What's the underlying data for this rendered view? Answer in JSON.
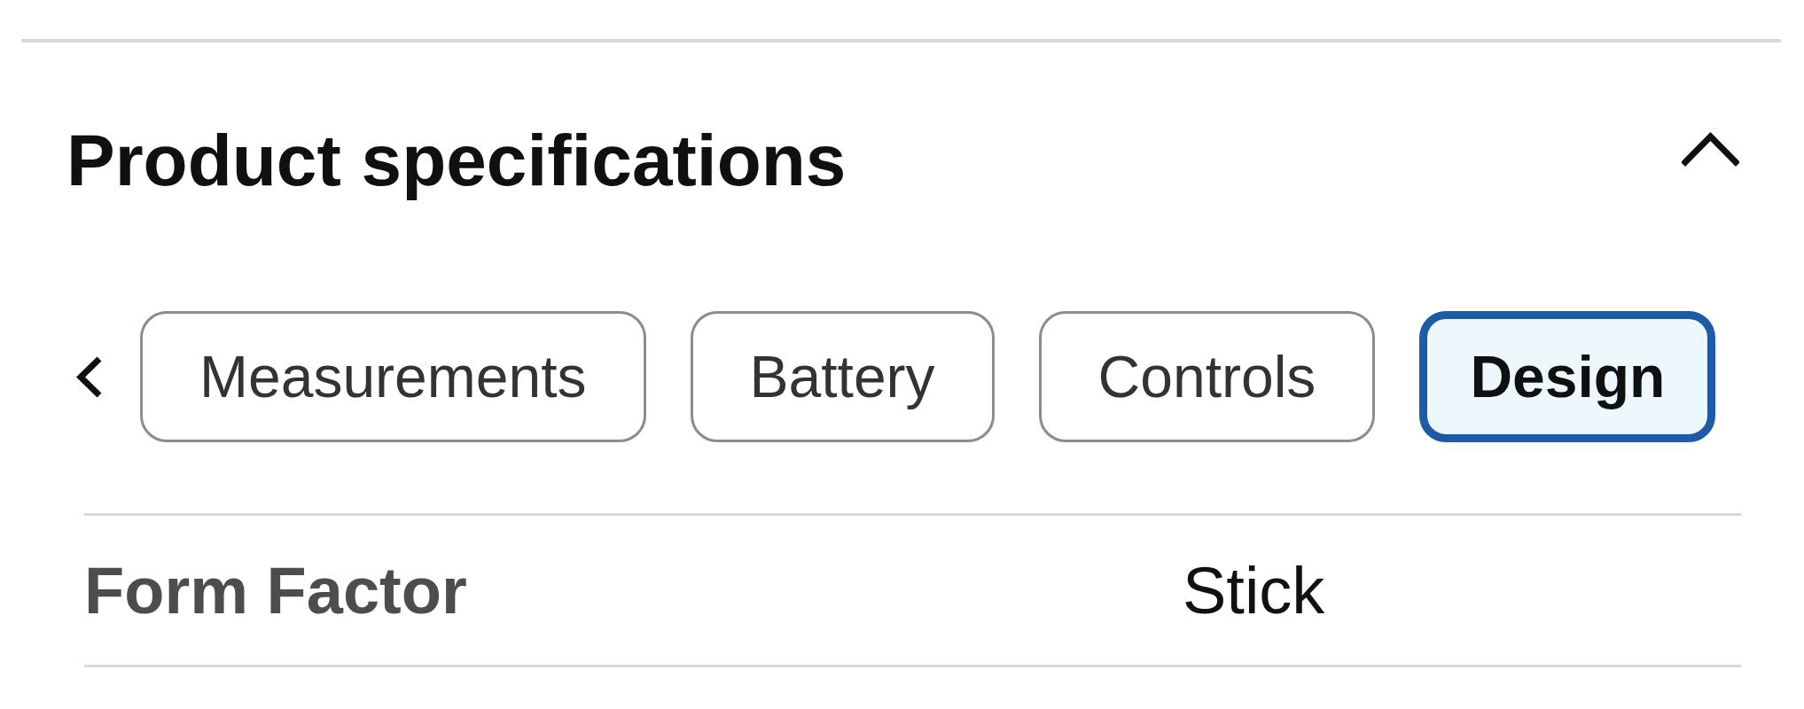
{
  "section": {
    "title": "Product specifications",
    "expanded": true
  },
  "tabs": [
    {
      "label": "Measurements",
      "selected": false
    },
    {
      "label": "Battery",
      "selected": false
    },
    {
      "label": "Controls",
      "selected": false
    },
    {
      "label": "Design",
      "selected": true
    }
  ],
  "specs": [
    {
      "label": "Form Factor",
      "value": "Stick"
    }
  ]
}
